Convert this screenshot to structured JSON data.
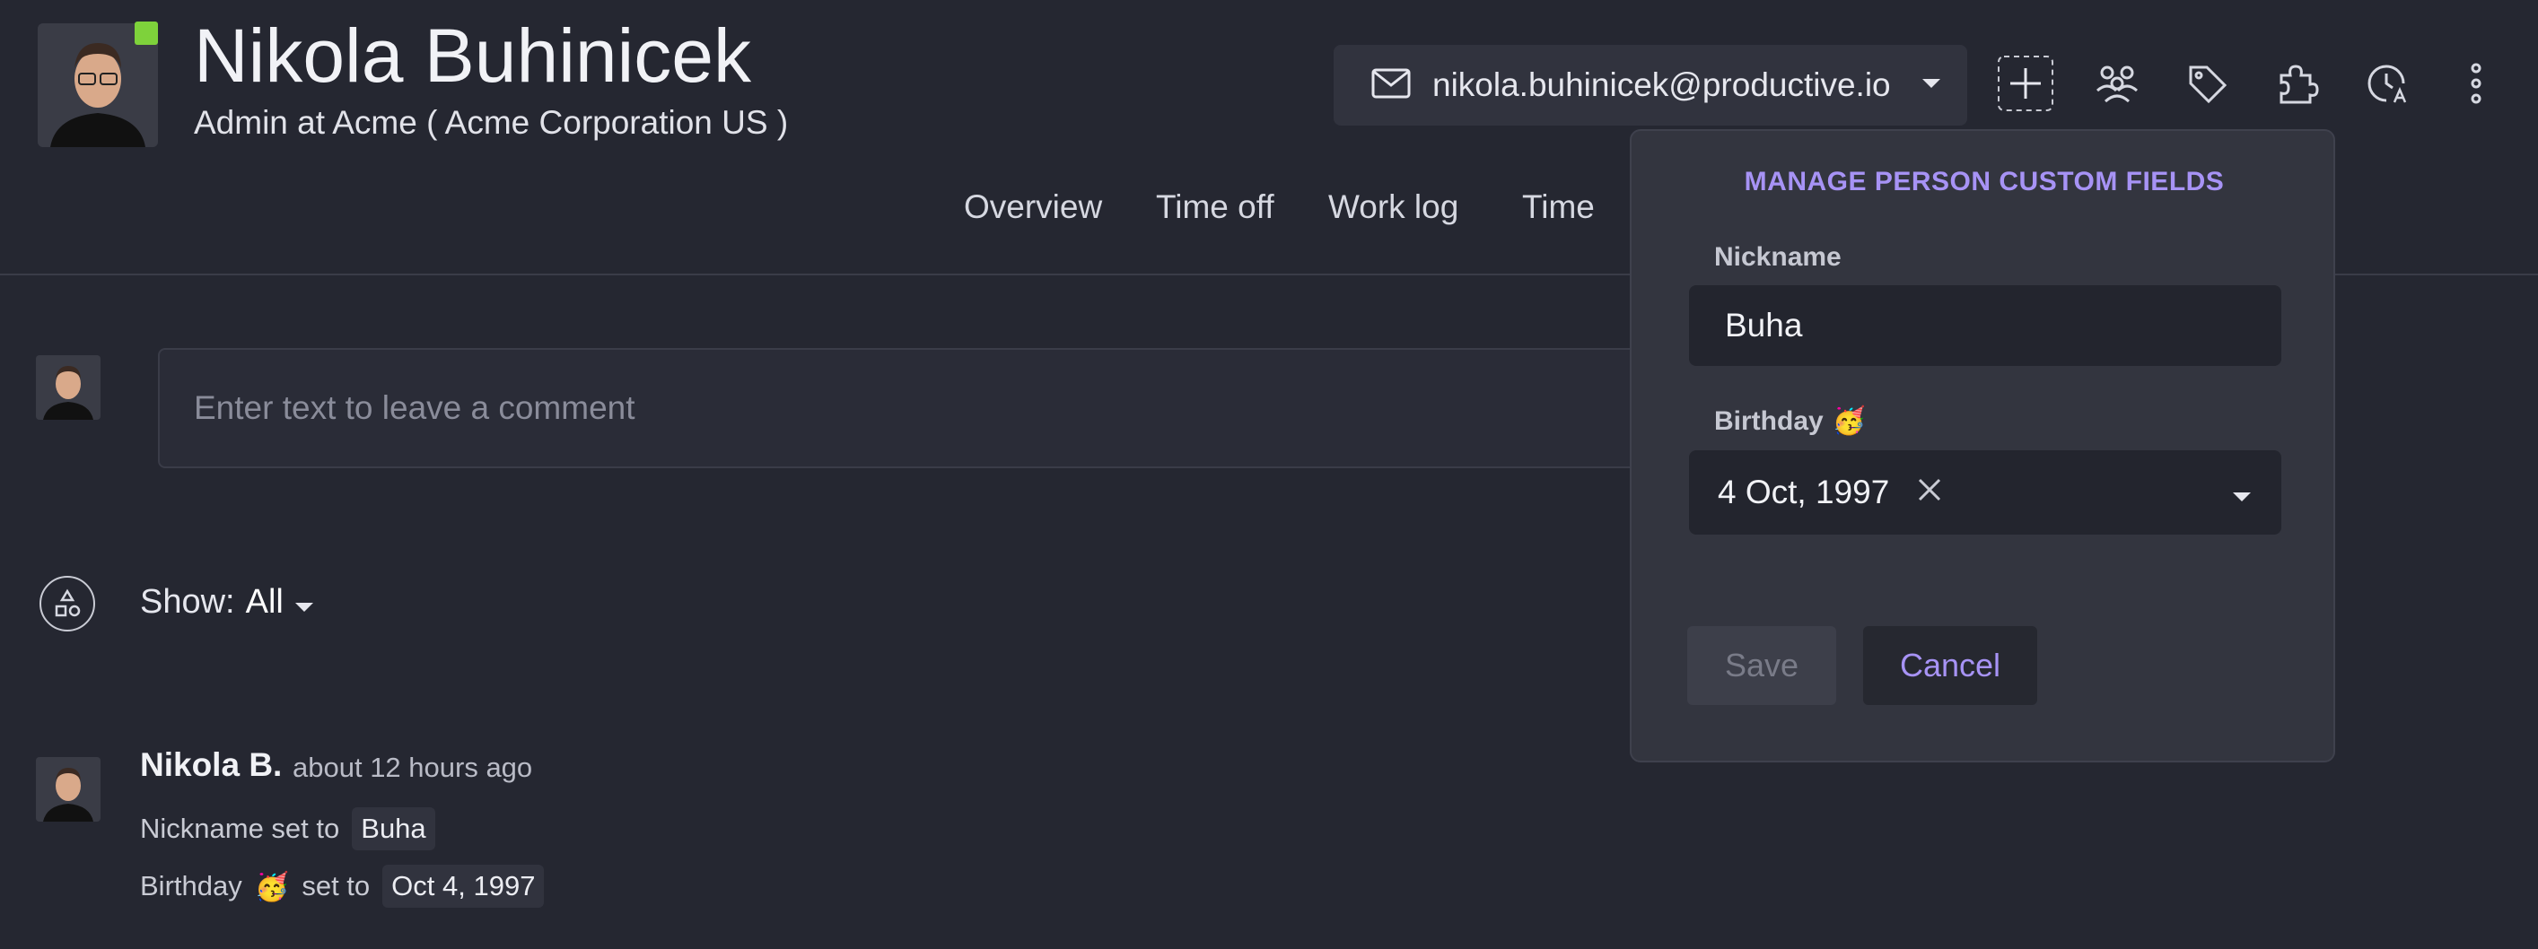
{
  "person": {
    "name": "Nikola Buhinicek",
    "role": "Admin at Acme ( Acme Corporation US )",
    "email": "nikola.buhinicek@productive.io"
  },
  "toolbar": {
    "icons": [
      "plus-icon",
      "people-icon",
      "tag-icon",
      "puzzle-icon",
      "clock-icon",
      "more-vertical-icon"
    ]
  },
  "tabs": [
    "Overview",
    "Time off",
    "Work log",
    "Time"
  ],
  "comment": {
    "placeholder": "Enter text to leave a comment"
  },
  "filter": {
    "label": "Show:",
    "value": "All"
  },
  "activity": {
    "author": "Nikola B.",
    "time": "about 12 hours ago",
    "nickname_prefix": "Nickname set to",
    "nickname_value": "Buha",
    "birthday_prefix": "Birthday",
    "birthday_emoji": "🥳",
    "birthday_suffix": "set to",
    "birthday_value": "Oct 4, 1997"
  },
  "popover": {
    "title": "MANAGE PERSON CUSTOM FIELDS",
    "nickname_label": "Nickname",
    "nickname_value": "Buha",
    "birthday_label": "Birthday",
    "birthday_emoji": "🥳",
    "birthday_value": "4 Oct, 1997",
    "save_label": "Save",
    "cancel_label": "Cancel"
  },
  "colors": {
    "background": "#252731",
    "accent": "#a793f5",
    "status_online": "#7ed23b",
    "panel": "#33353f"
  }
}
